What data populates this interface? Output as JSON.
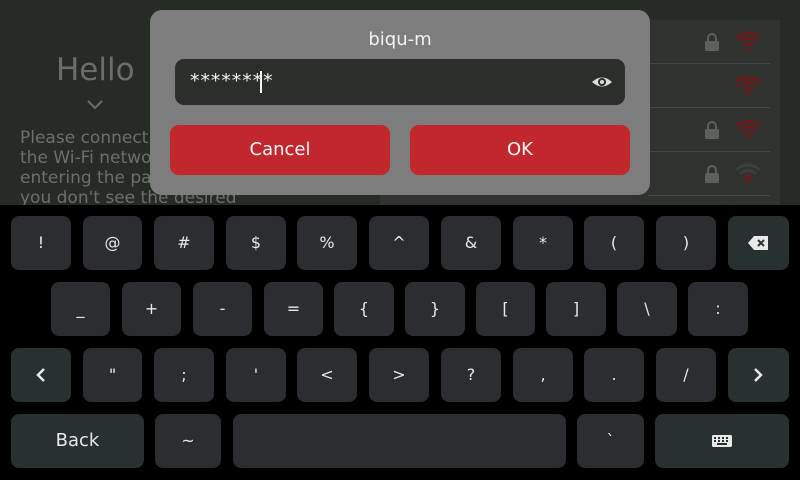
{
  "background": {
    "greeting": "Hello",
    "description": "Please connect to a network by selecting the Wi-Fi network from the list and then entering the password. Press refresh if you don't see the desired"
  },
  "dialog": {
    "title": "biqu-m",
    "password_value": "********",
    "cancel_label": "Cancel",
    "ok_label": "OK"
  },
  "keyboard": {
    "row1": [
      "!",
      "@",
      "#",
      "$",
      "%",
      "^",
      "&",
      "*",
      "(",
      ")"
    ],
    "row2": [
      "_",
      "+",
      "-",
      "=",
      "{",
      "}",
      "[",
      "]",
      "\\",
      ":"
    ],
    "row3": [
      "\"",
      ";",
      "'",
      "<",
      ">",
      "?",
      ",",
      ".",
      "/"
    ],
    "back_label": "Back",
    "tilde": "~",
    "backtick": "`"
  },
  "colors": {
    "accent": "#c1272d",
    "dialog_bg": "#7d7d7d",
    "key_bg": "#2c2d31",
    "func_key_bg": "#283030"
  }
}
